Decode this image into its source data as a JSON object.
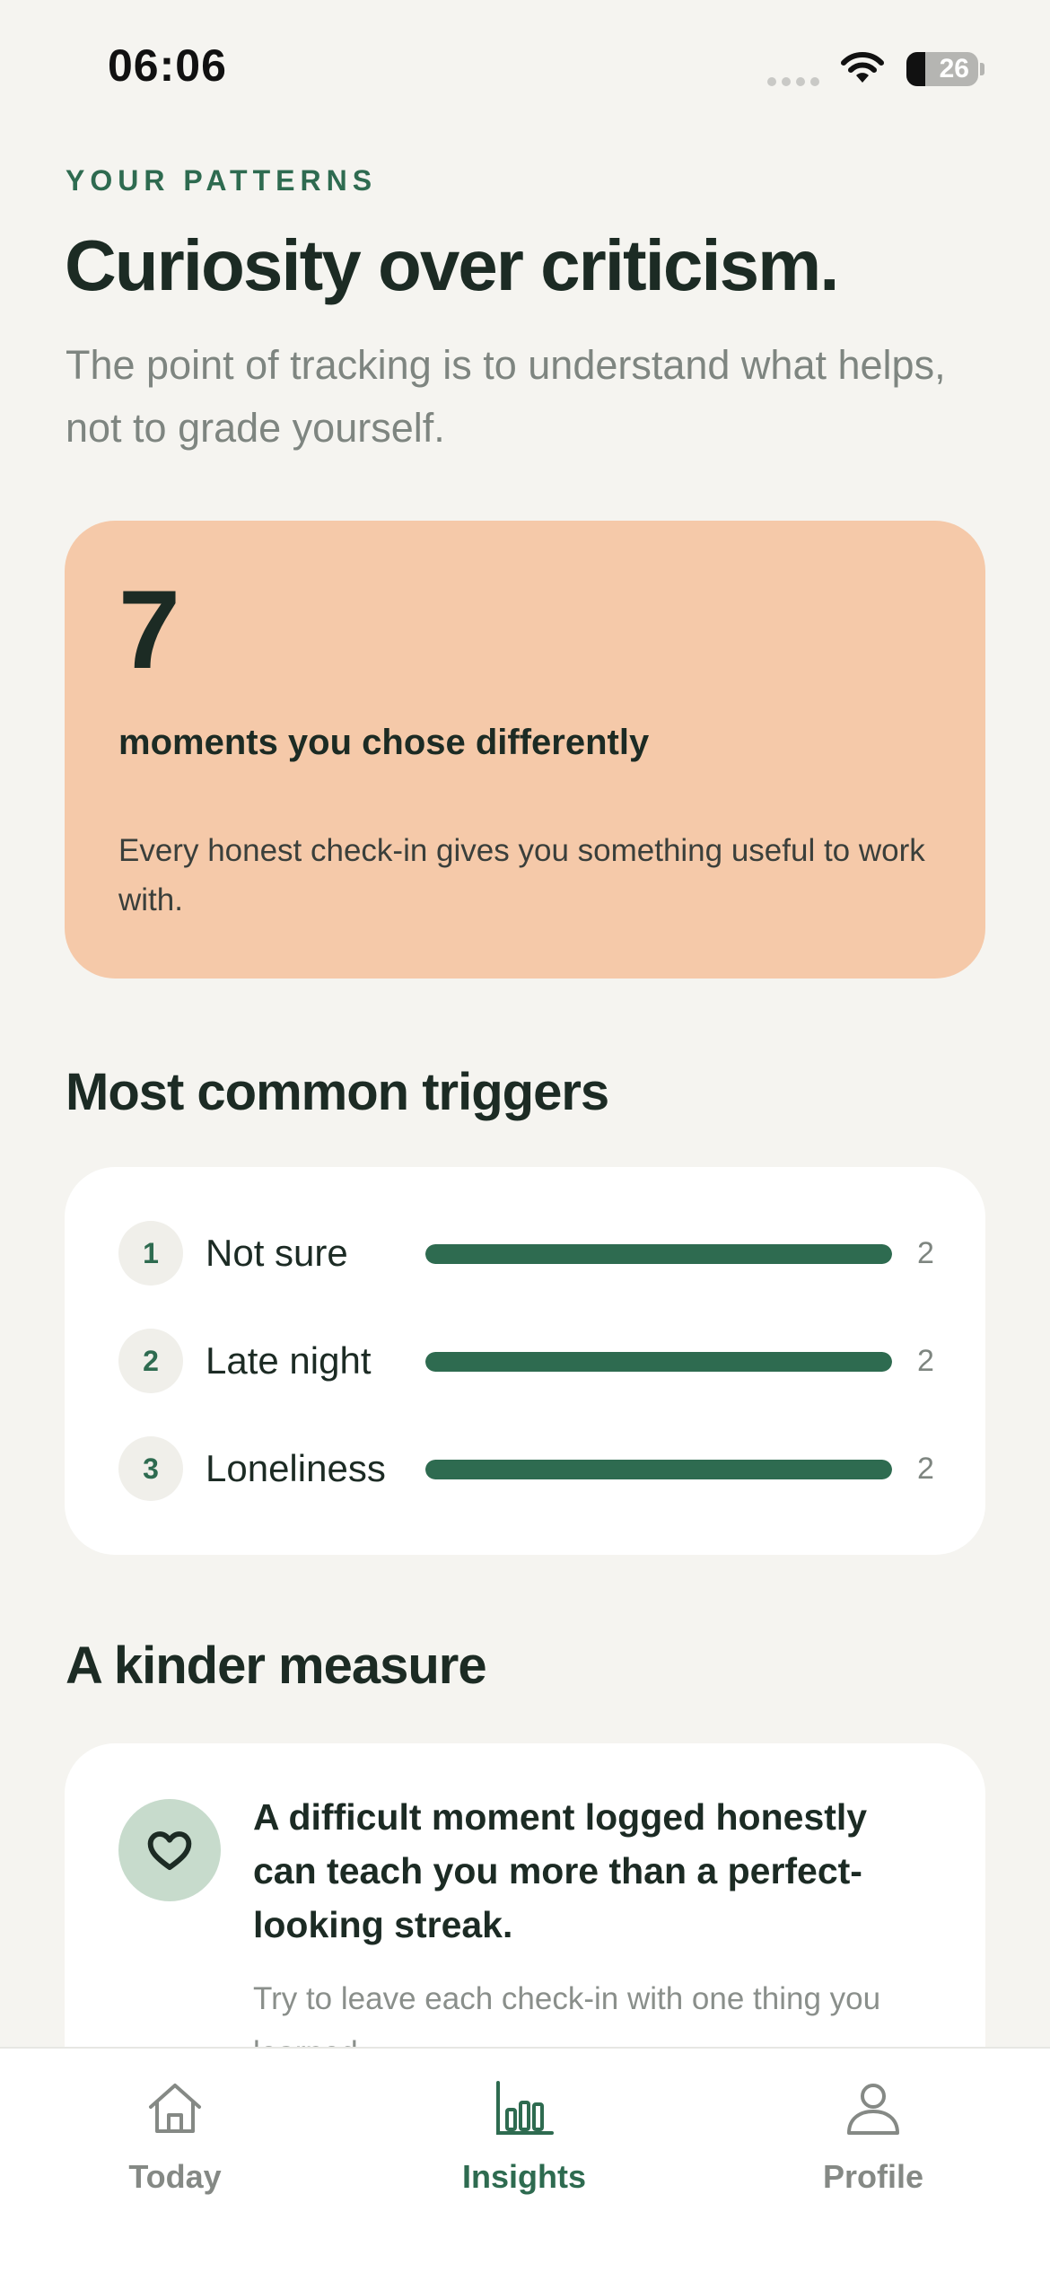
{
  "status_bar": {
    "time": "06:06",
    "battery": "26",
    "battery_level": 0.26
  },
  "header": {
    "eyebrow": "YOUR PATTERNS",
    "title": "Curiosity over criticism.",
    "subtitle": "The point of tracking is to understand what helps, not to grade yourself."
  },
  "highlight": {
    "number": "7",
    "label": "moments you chose differently",
    "note": "Every honest check-in gives you something useful to work with.",
    "background": "#f5c9a9"
  },
  "triggers": {
    "title": "Most common triggers",
    "items": [
      {
        "rank": "1",
        "name": "Not sure",
        "count": "2",
        "level": 1.0
      },
      {
        "rank": "2",
        "name": "Late night",
        "count": "2",
        "level": 1.0
      },
      {
        "rank": "3",
        "name": "Loneliness",
        "count": "2",
        "level": 1.0
      }
    ],
    "bar_color": "#2e6b50"
  },
  "kinder": {
    "title": "A kinder measure",
    "icon": "heart-icon",
    "main": "A difficult moment logged honestly can teach you more than a perfect-looking streak.",
    "sub": "Try to leave each check-in with one thing you learned."
  },
  "tabs": [
    {
      "label": "Today",
      "icon": "home-icon",
      "active": false
    },
    {
      "label": "Insights",
      "icon": "bar-chart-icon",
      "active": true
    },
    {
      "label": "Profile",
      "icon": "person-icon",
      "active": false
    }
  ],
  "colors": {
    "accent": "#2e6b50",
    "background": "#f5f4f0",
    "muted_text": "#7e8580"
  }
}
